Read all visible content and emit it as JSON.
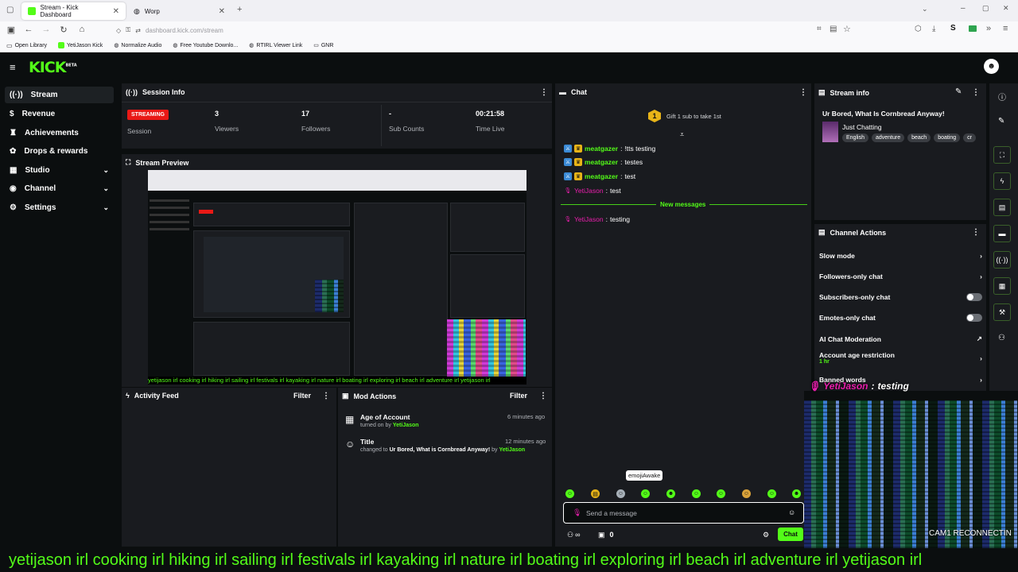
{
  "browser": {
    "tabs": [
      {
        "title": "Stream - Kick Dashboard",
        "active": true
      },
      {
        "title": "Worp",
        "active": false
      }
    ],
    "url": "dashboard.kick.com/stream",
    "bookmarks": [
      "Open Library",
      "YetiJason Kick",
      "Normalize Audio",
      "Free Youtube Downlo...",
      "RTIRL Viewer Link",
      "GNR"
    ]
  },
  "app": {
    "logo": "KICK",
    "logo_badge": "BETA"
  },
  "sidebar": {
    "items": [
      {
        "label": "Stream",
        "icon": "stream-icon",
        "active": true
      },
      {
        "label": "Revenue",
        "icon": "dollar-icon"
      },
      {
        "label": "Achievements",
        "icon": "trophy-icon"
      },
      {
        "label": "Drops & rewards",
        "icon": "gift-icon"
      },
      {
        "label": "Studio",
        "icon": "studio-icon",
        "expandable": true
      },
      {
        "label": "Channel",
        "icon": "channel-icon",
        "expandable": true
      },
      {
        "label": "Settings",
        "icon": "gear-icon",
        "expandable": true
      }
    ]
  },
  "session_info": {
    "title": "Session Info",
    "status_badge": "STREAMING",
    "status_label": "Session",
    "stats": [
      {
        "value": "3",
        "label": "Viewers"
      },
      {
        "value": "17",
        "label": "Followers"
      },
      {
        "value": "-",
        "label": "Sub Counts"
      },
      {
        "value": "00:21:58",
        "label": "Time Live"
      }
    ]
  },
  "stream_preview": {
    "title": "Stream Preview",
    "ticker": "yetijason irl cooking irl hiking irl sailing irl festivals irl kayaking irl nature irl boating irl exploring irl beach irl adventure irl yetijason irl"
  },
  "activity_feed": {
    "title": "Activity Feed",
    "filter_label": "Filter"
  },
  "mod_actions": {
    "title": "Mod Actions",
    "filter_label": "Filter",
    "items": [
      {
        "title": "Age of Account",
        "detail_prefix": "turned on by",
        "detail_highlight": "",
        "detail_mid": "",
        "user": "YetiJason",
        "time": "6 minutes ago"
      },
      {
        "title": "Title",
        "detail_prefix": "changed to",
        "detail_highlight": "Ur Bored, What is Cornbread Anyway!",
        "detail_mid": "by",
        "user": "YetiJason",
        "time": "12 minutes ago"
      }
    ]
  },
  "chat": {
    "title": "Chat",
    "gift_text": "Gift 1 sub to take 1st",
    "gift_count": "1",
    "messages": [
      {
        "user": "meatgazer",
        "text": "!tts testing",
        "user_color": "#53fc18"
      },
      {
        "user": "meatgazer",
        "text": "testes",
        "user_color": "#53fc18"
      },
      {
        "user": "meatgazer",
        "text": "test",
        "user_color": "#53fc18"
      },
      {
        "user": "YetiJason",
        "text": "test",
        "user_color": "#e91eac"
      }
    ],
    "new_messages_label": "New messages",
    "new_messages": [
      {
        "user": "YetiJason",
        "text": "testing",
        "user_color": "#e91eac"
      }
    ],
    "emote_tooltip": "emojiAwake",
    "input_placeholder": "Send a message",
    "footer_count": "0",
    "footer_infinity": "∞",
    "send_label": "Chat"
  },
  "stream_info": {
    "title": "Stream info",
    "stream_title": "Ur Bored, What Is Cornbread Anyway!",
    "category": "Just Chatting",
    "tags": [
      "English",
      "adventure",
      "beach",
      "boating",
      "cr"
    ]
  },
  "channel_actions": {
    "title": "Channel Actions",
    "items": [
      {
        "label": "Slow mode",
        "control": "chevron"
      },
      {
        "label": "Followers-only chat",
        "control": "chevron"
      },
      {
        "label": "Subscribers-only chat",
        "control": "toggle"
      },
      {
        "label": "Emotes-only chat",
        "control": "toggle"
      },
      {
        "label": "AI Chat Moderation",
        "control": "external"
      },
      {
        "label": "Account age restriction",
        "sub": "1 hr",
        "control": "chevron"
      },
      {
        "label": "Banned words",
        "control": "chevron"
      }
    ]
  },
  "overlay": {
    "tts_user": "YetiJason",
    "tts_text": "testing",
    "cam_status": "CAM1 RECONNECTIN",
    "ticker": "yetijason irl cooking irl hiking irl sailing irl festivals irl kayaking irl nature irl boating irl exploring irl beach irl adventure irl yetijason irl"
  },
  "colors": {
    "accent": "#53fc18",
    "panel": "#191b1f",
    "background": "#0b0e0f",
    "live": "#e91916"
  }
}
